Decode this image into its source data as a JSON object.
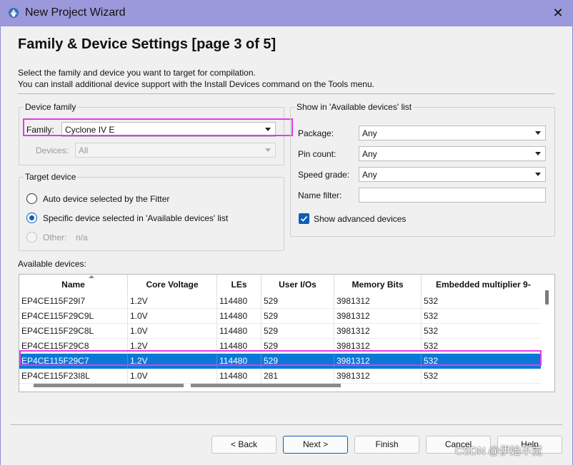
{
  "window": {
    "title": "New Project Wizard",
    "close_glyph": "✕"
  },
  "page": {
    "heading": "Family & Device Settings [page 3 of 5]",
    "description_1": "Select the family and device you want to target for compilation.",
    "description_2": "You can install additional device support with the Install Devices command on the Tools menu."
  },
  "device_family": {
    "group_label": "Device family",
    "family_label": "Family:",
    "family_value": "Cyclone IV E",
    "devices_label": "Devices:",
    "devices_value": "All"
  },
  "target_device": {
    "group_label": "Target device",
    "options": [
      {
        "label": "Auto device selected by the Fitter",
        "checked": false,
        "disabled": false
      },
      {
        "label": "Specific device selected in 'Available devices' list",
        "checked": true,
        "disabled": false
      },
      {
        "label": "Other:",
        "checked": false,
        "disabled": true
      }
    ],
    "other_value": "n/a"
  },
  "show_in_list": {
    "group_label": "Show in 'Available devices' list",
    "package_label": "Package:",
    "package_value": "Any",
    "pin_count_label": "Pin count:",
    "pin_count_value": "Any",
    "speed_grade_label": "Speed grade:",
    "speed_grade_value": "Any",
    "name_filter_label": "Name filter:",
    "name_filter_value": "",
    "show_advanced_label": "Show advanced devices",
    "show_advanced_checked": true
  },
  "available_devices": {
    "label": "Available devices:",
    "columns": [
      "Name",
      "Core Voltage",
      "LEs",
      "User I/Os",
      "Memory Bits",
      "Embedded multiplier 9-"
    ],
    "rows": [
      [
        "EP4CE115F29I7",
        "1.2V",
        "114480",
        "529",
        "3981312",
        "532"
      ],
      [
        "EP4CE115F29C9L",
        "1.0V",
        "114480",
        "529",
        "3981312",
        "532"
      ],
      [
        "EP4CE115F29C8L",
        "1.0V",
        "114480",
        "529",
        "3981312",
        "532"
      ],
      [
        "EP4CE115F29C8",
        "1.2V",
        "114480",
        "529",
        "3981312",
        "532"
      ],
      [
        "EP4CE115F29C7",
        "1.2V",
        "114480",
        "529",
        "3981312",
        "532"
      ],
      [
        "EP4CE115F23I8L",
        "1.0V",
        "114480",
        "281",
        "3981312",
        "532"
      ]
    ],
    "selected_row": 4
  },
  "buttons": {
    "back": "< Back",
    "next": "Next >",
    "finish": "Finish",
    "cancel": "Cancel",
    "help": "Help"
  },
  "watermark": "CSDN @伊始不觉",
  "colors": {
    "titlebar": "#9b98db",
    "selection": "#0a78d7",
    "highlight": "#e43be4",
    "accent": "#0b5db8"
  },
  "icons": {
    "app": "wizard-app-icon",
    "close": "close-icon",
    "dropdown": "chevron-down-icon",
    "checkbox": "checkmark-icon"
  }
}
